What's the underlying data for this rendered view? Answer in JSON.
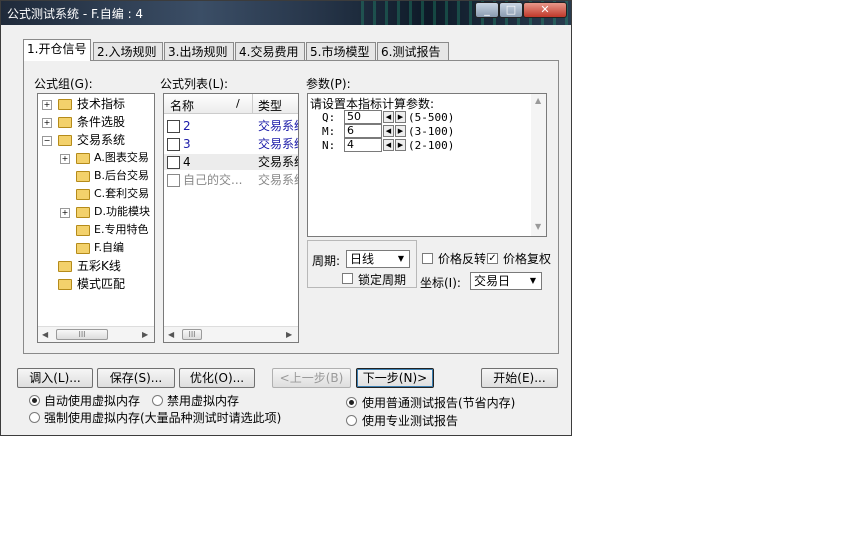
{
  "window": {
    "title": "公式测试系统 - F.自编 : 4"
  },
  "tabs": [
    {
      "label": "1.开仓信号"
    },
    {
      "label": "2.入场规则"
    },
    {
      "label": "3.出场规则"
    },
    {
      "label": "4.交易费用"
    },
    {
      "label": "5.市场模型"
    },
    {
      "label": "6.测试报告"
    }
  ],
  "formula_group": {
    "label": "公式组(G):",
    "items": [
      {
        "label": "技术指标"
      },
      {
        "label": "条件选股"
      },
      {
        "label": "交易系统"
      },
      {
        "label": "A.图表交易"
      },
      {
        "label": "B.后台交易"
      },
      {
        "label": "C.套利交易"
      },
      {
        "label": "D.功能模块"
      },
      {
        "label": "E.专用特色"
      },
      {
        "label": "F.自编"
      },
      {
        "label": "五彩K线"
      },
      {
        "label": "模式匹配"
      }
    ]
  },
  "formula_list": {
    "label": "公式列表(L):",
    "col_name": "名称",
    "col_sort": "/",
    "col_type": "类型",
    "rows": [
      {
        "name": "2",
        "type": "交易系统"
      },
      {
        "name": "3",
        "type": "交易系统"
      },
      {
        "name": "4",
        "type": "交易系统"
      },
      {
        "name": "自己的交...",
        "type": "交易系统"
      }
    ]
  },
  "params": {
    "label": "参数(P):",
    "heading": "请设置本指标计算参数:",
    "items": [
      {
        "name": "Q:",
        "value": "50",
        "range": "(5-500)"
      },
      {
        "name": "M:",
        "value": "6",
        "range": "(3-100)"
      },
      {
        "name": "N:",
        "value": "4",
        "range": "(2-100)"
      }
    ]
  },
  "period": {
    "label": "周期:",
    "value": "日线",
    "lock_label": "锁定周期"
  },
  "price_reverse_label": "价格反转",
  "price_adjust_label": "价格复权",
  "coord": {
    "label": "坐标(I):",
    "value": "交易日"
  },
  "buttons": {
    "load": "调入(L)...",
    "save": "保存(S)...",
    "optimize": "优化(O)...",
    "prev": "<上一步(B)",
    "next": "下一步(N)>",
    "start": "开始(E)..."
  },
  "memory": {
    "auto": "自动使用虚拟内存",
    "disable": "禁用虚拟内存",
    "force": "强制使用虚拟内存(大量品种测试时请选此项)"
  },
  "report": {
    "normal": "使用普通测试报告(节省内存)",
    "pro": "使用专业测试报告"
  }
}
